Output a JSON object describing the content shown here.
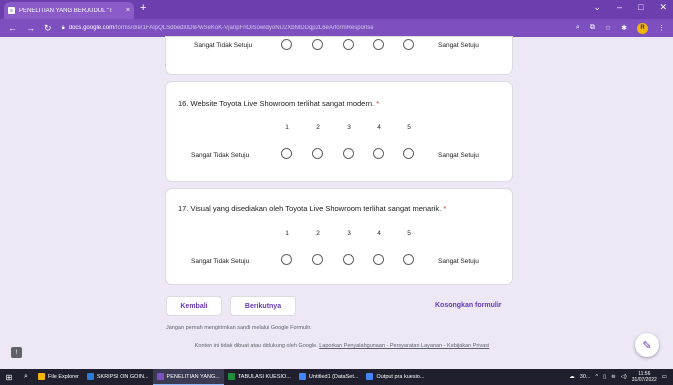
{
  "browser": {
    "tab_title": "PENELITIAN YANG BERJUDUL \"T",
    "tab_close": "×",
    "new_tab": "+",
    "url_host": "docs.google.com",
    "url_path": "/forms/d/e/1FAIpQLSdbedl0DliPwSeKoK-VjanpFriOiSowldyoNU2XbNlDDqp2L6eA/formResponse",
    "win_min": "–",
    "win_max": "□",
    "win_close": "✕",
    "profile_initial": "R"
  },
  "form": {
    "prev_row": {
      "left_label": "Sangat Tidak Setuju",
      "right_label": "Sangat Setuju"
    },
    "questions": [
      {
        "title": "16. Website Toyota Live Showroom terlihat sangat modern.",
        "required_mark": "*",
        "scale": [
          "1",
          "2",
          "3",
          "4",
          "5"
        ],
        "left_label": "Sangat Tidak Setuju",
        "right_label": "Sangat Setuju"
      },
      {
        "title": "17. Visual yang disediakan oleh Toyota Live Showroom terlihat sangat menarik.",
        "required_mark": "*",
        "scale": [
          "1",
          "2",
          "3",
          "4",
          "5"
        ],
        "left_label": "Sangat Tidak Setuju",
        "right_label": "Sangat Setuju"
      }
    ],
    "back_label": "Kembali",
    "next_label": "Berikutnya",
    "clear_label": "Kosongkan formulir",
    "footnote": "Jangan pernah mengirimkan sandi melalui Google Formulir.",
    "disclaimer_text": "Konten ini tidak dibuat atau didukung oleh Google.",
    "disclaimer_links": "Laporkan Penyalahgunaan - Persyaratan Layanan - Kebijakan Privasi"
  },
  "taskbar": {
    "items": [
      {
        "label": "File Explorer",
        "color": "#f2b705"
      },
      {
        "label": "SKRIPSI ON GOIN...",
        "color": "#2b7cd3"
      },
      {
        "label": "PENELITIAN YANG...",
        "color": "#7e4fbf"
      },
      {
        "label": "TABULASI KUESIO...",
        "color": "#1e8e3e"
      },
      {
        "label": "Untitled1 (DataSet...",
        "color": "#4285f4"
      },
      {
        "label": "Output pra kuesio...",
        "color": "#4285f4"
      }
    ],
    "tray_text": "30...",
    "time": "11:56",
    "date": "31/07/2022"
  },
  "colors": {
    "accent": "#673ab7",
    "background": "#ede7f6",
    "required": "#d93025"
  }
}
